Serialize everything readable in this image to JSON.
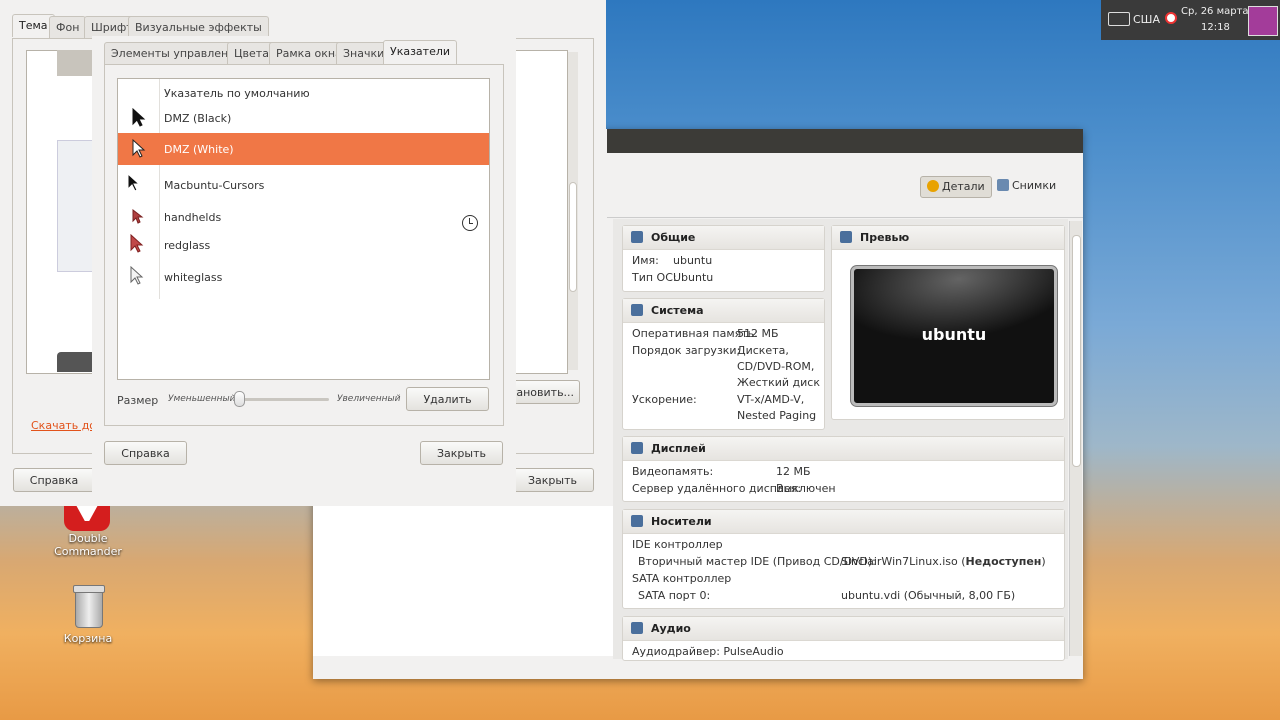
{
  "tray": {
    "layout": "США",
    "date": "Ср, 26 марта",
    "time": "12:18"
  },
  "desktop": {
    "icons": [
      {
        "label": "Double Commander",
        "icon": "double-commander-icon"
      },
      {
        "label": "Корзина",
        "icon": "trash-icon"
      }
    ]
  },
  "appearance": {
    "tabs": [
      "Тема",
      "Фон",
      "Шрифт",
      "Визуальные эффекты"
    ],
    "active_tab": "Тема",
    "download_link": "Скачать доп",
    "install_btn": "тановить...",
    "help_btn": "Справка",
    "close_btn": "Закрыть"
  },
  "customize": {
    "tabs": [
      "Элементы управления",
      "Цвета",
      "Рамка окна",
      "Значки",
      "Указатели"
    ],
    "active_tab": "Указатели",
    "items": [
      {
        "label": "Указатель по умолчанию",
        "icon": "none"
      },
      {
        "label": "DMZ (Black)",
        "icon": "black-cursor-icon"
      },
      {
        "label": "DMZ (White)",
        "icon": "white-cursor-icon",
        "selected": true
      },
      {
        "label": "Macbuntu-Cursors",
        "icon": "black-cursor-icon"
      },
      {
        "label": "handhelds",
        "icon": "red-cursor-icon"
      },
      {
        "label": "redglass",
        "icon": "red-cursor-icon"
      },
      {
        "label": "whiteglass",
        "icon": "white-cursor-icon"
      }
    ],
    "size_label": "Размер",
    "size_min": "Уменьшенный",
    "size_max": "Увеличенный",
    "size_value": 0,
    "delete_btn": "Удалить",
    "help_btn": "Справка",
    "close_btn": "Закрыть"
  },
  "vbox": {
    "toolbar": {
      "details": "Детали",
      "snapshots": "Снимки"
    },
    "general": {
      "title": "Общие",
      "name_key": "Имя:",
      "name_val": "ubuntu",
      "os_key": "Тип ОС:",
      "os_val": "Ubuntu"
    },
    "preview": {
      "title": "Превью",
      "screen_text": "ubuntu"
    },
    "system": {
      "title": "Система",
      "ram_key": "Оперативная память:",
      "ram_val": "512 МБ",
      "boot_key": "Порядок загрузки:",
      "boot_vals": [
        "Дискета,",
        "CD/DVD-ROM,",
        "Жесткий диск"
      ],
      "accel_key": "Ускорение:",
      "accel_vals": [
        "VT-x/AMD-V,",
        "Nested Paging"
      ]
    },
    "display": {
      "title": "Дисплей",
      "vram_key": "Видеопамять:",
      "vram_val": "12 МБ",
      "rds_key": "Сервер удалённого дисплея:",
      "rds_val": "Выключен"
    },
    "storage": {
      "title": "Носители",
      "ide": "IDE контроллер",
      "ide_slave_key": "Вторичный мастер IDE (Привод CD/DVD):",
      "ide_slave_val": "SinclairWin7Linux.iso (",
      "ide_slave_status": "Недоступен",
      "ide_slave_end": ")",
      "sata": "SATA контроллер",
      "sata_port_key": "SATA порт 0:",
      "sata_port_val": "ubuntu.vdi (Обычный, 8,00 ГБ)"
    },
    "audio": {
      "title": "Аудио",
      "driver": "Аудиодрайвер: PulseAudio"
    }
  }
}
